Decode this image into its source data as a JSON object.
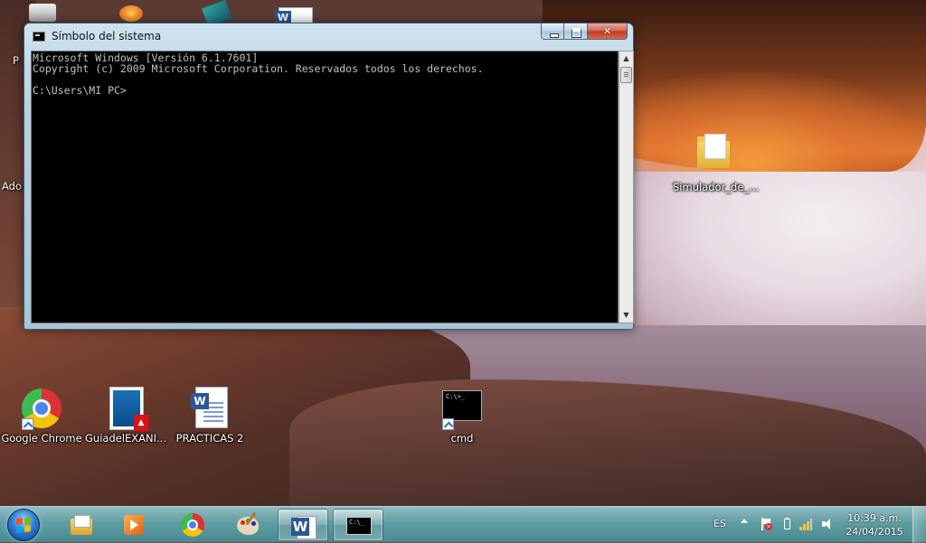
{
  "window": {
    "title": "Símbolo del sistema",
    "console_text": "Microsoft Windows [Versión 6.1.7601]\nCopyright (c) 2009 Microsoft Corporation. Reservados todos los derechos.\n\nC:\\Users\\MI PC>"
  },
  "desktop": {
    "partial_labels": {
      "left_top": "P",
      "left_mid": "Ado"
    },
    "icons": [
      {
        "label": "Google Chrome",
        "icon": "chrome-icon"
      },
      {
        "label": "GuiadelEXANI...",
        "icon": "pdf-icon"
      },
      {
        "label": "PRACTICAS 2",
        "icon": "word-document-icon"
      },
      {
        "label": "cmd",
        "icon": "cmd-icon"
      },
      {
        "label": "Simulador_de_...",
        "icon": "folder-icon"
      }
    ]
  },
  "taskbar": {
    "pinned": [
      "windows-explorer",
      "media-player",
      "chrome",
      "paint",
      "word",
      "cmd"
    ],
    "active": [
      "word",
      "cmd"
    ],
    "tray": {
      "language": "ES",
      "time": "10:39 a.m.",
      "date": "24/04/2015"
    }
  },
  "colors": {
    "console_bg": "#000000",
    "console_text": "#c0c0c0",
    "taskbar": "#5fa5aa",
    "close_button": "#c0391e"
  }
}
